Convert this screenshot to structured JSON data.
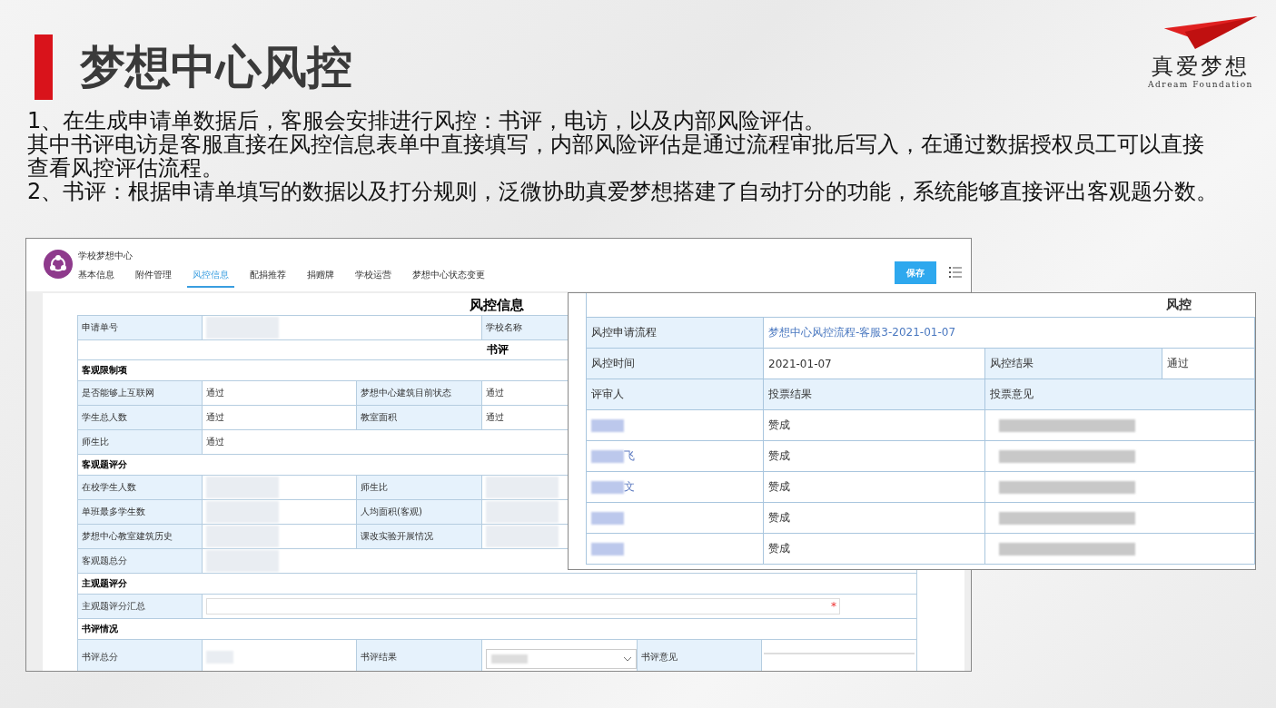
{
  "slide": {
    "title": "梦想中心风控",
    "logo": {
      "name": "真爱梦想",
      "tagline": "Adream Foundation"
    },
    "paragraphs": [
      "1、在生成申请单数据后，客服会安排进行风控：书评，电访，以及内部风险评估。",
      "其中书评电访是客服直接在风控信息表单中直接填写，内部风险评估是通过流程审批后写入，在通过数据授权员工可以直接查看风控评估流程。",
      "2、书评：根据申请单填写的数据以及打分规则，泛微协助真爱梦想搭建了自动打分的功能，系统能够直接评出客观题分数。"
    ]
  },
  "form_window": {
    "app_title": "学校梦想中心",
    "tabs": [
      {
        "label": "基本信息",
        "selected": false
      },
      {
        "label": "附件管理",
        "selected": false
      },
      {
        "label": "风控信息",
        "selected": true
      },
      {
        "label": "配捐推荐",
        "selected": false
      },
      {
        "label": "捐赠牌",
        "selected": false
      },
      {
        "label": "学校运营",
        "selected": false
      },
      {
        "label": "梦想中心状态变更",
        "selected": false
      }
    ],
    "save_button": "保存",
    "form_title": "风控信息",
    "rows": [
      {
        "kind": "fields",
        "cells": [
          {
            "kind": "label",
            "text": "申请单号"
          },
          {
            "kind": "wide2",
            "redacted": true
          },
          {
            "kind": "label",
            "text": "学校名称"
          }
        ]
      },
      {
        "kind": "title",
        "text": "书评"
      },
      {
        "kind": "section",
        "text": "客观限制项"
      },
      {
        "kind": "fields",
        "cells": [
          {
            "kind": "label",
            "text": "是否能够上互联网"
          },
          {
            "kind": "value",
            "text": "通过"
          },
          {
            "kind": "label",
            "text": "梦想中心建筑目前状态"
          },
          {
            "kind": "value",
            "text": "通过"
          }
        ]
      },
      {
        "kind": "fields",
        "cells": [
          {
            "kind": "label",
            "text": "学生总人数"
          },
          {
            "kind": "value",
            "text": "通过"
          },
          {
            "kind": "label",
            "text": "教室面积"
          },
          {
            "kind": "value",
            "text": "通过"
          }
        ]
      },
      {
        "kind": "fields",
        "cells": [
          {
            "kind": "label",
            "text": "师生比"
          },
          {
            "kind": "wide3",
            "text": "通过"
          }
        ]
      },
      {
        "kind": "section",
        "text": "客观题评分"
      },
      {
        "kind": "fields",
        "cells": [
          {
            "kind": "label",
            "text": "在校学生人数"
          },
          {
            "kind": "value",
            "redacted": true
          },
          {
            "kind": "label",
            "text": "师生比"
          },
          {
            "kind": "value",
            "redacted": true
          }
        ]
      },
      {
        "kind": "fields",
        "cells": [
          {
            "kind": "label",
            "text": "单班最多学生数"
          },
          {
            "kind": "value",
            "redacted": true
          },
          {
            "kind": "label",
            "text": "人均面积(客观)"
          },
          {
            "kind": "value",
            "redacted": true
          }
        ]
      },
      {
        "kind": "fields",
        "cells": [
          {
            "kind": "label",
            "text": "梦想中心教室建筑历史"
          },
          {
            "kind": "value",
            "redacted": true
          },
          {
            "kind": "label",
            "text": "课改实验开展情况"
          },
          {
            "kind": "value",
            "redacted": true
          }
        ]
      },
      {
        "kind": "fields",
        "cells": [
          {
            "kind": "label",
            "text": "客观题总分"
          },
          {
            "kind": "wide3",
            "redacted": true
          }
        ]
      },
      {
        "kind": "section",
        "text": "主观题评分"
      },
      {
        "kind": "fields",
        "cells": [
          {
            "kind": "label",
            "text": "主观题评分汇总"
          },
          {
            "kind": "input",
            "required_mark": "*"
          }
        ]
      },
      {
        "kind": "section",
        "text": "书评情况"
      },
      {
        "kind": "tall",
        "cells": [
          {
            "kind": "label",
            "text": "书评总分"
          },
          {
            "kind": "value",
            "redacted": true
          },
          {
            "kind": "label",
            "text": "书评结果"
          },
          {
            "kind": "select",
            "redacted": true
          },
          {
            "kind": "label",
            "text": "书评意见"
          },
          {
            "kind": "textarea"
          }
        ]
      }
    ]
  },
  "risk_window": {
    "title": "风控",
    "process_label": "风控申请流程",
    "process_link": "梦想中心风控流程-客服3-2021-01-07",
    "time_label": "风控时间",
    "time_value": "2021-01-07",
    "result_label": "风控结果",
    "result_value": "通过",
    "columns": [
      "评审人",
      "投票结果",
      "投票意见"
    ],
    "reviews": [
      {
        "reviewer_redacted": true,
        "vote": "赞成",
        "opinion_redacted": true
      },
      {
        "reviewer_redacted": true,
        "reviewer_tail": "飞",
        "vote": "赞成",
        "opinion_redacted": true
      },
      {
        "reviewer_redacted": true,
        "reviewer_tail": "文",
        "vote": "赞成",
        "opinion_redacted": true
      },
      {
        "reviewer_redacted": true,
        "vote": "赞成",
        "opinion_redacted": true
      },
      {
        "reviewer_redacted": true,
        "vote": "赞成",
        "opinion_redacted": true
      }
    ]
  }
}
